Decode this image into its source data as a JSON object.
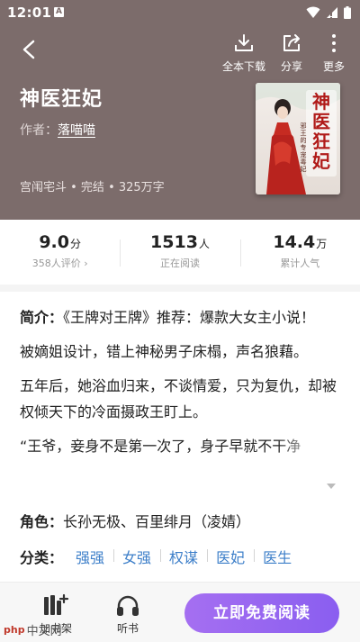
{
  "status_bar": {
    "time": "12:01",
    "notification_letter": "A"
  },
  "header": {
    "actions": [
      {
        "label": "全本下载",
        "icon": "download-icon"
      },
      {
        "label": "分享",
        "icon": "share-icon"
      },
      {
        "label": "更多",
        "icon": "more-vertical-icon"
      }
    ]
  },
  "book": {
    "title": "神医狂妃",
    "author_label": "作者：",
    "author": "落喵喵",
    "meta": "宫闱宅斗 • 完结 • 325万字",
    "cover_title": "神医狂妃",
    "cover_subtitle": "邪王的专宠毒妃"
  },
  "stats": [
    {
      "value": "9.0",
      "unit": "分",
      "sub": "358人评价 ›"
    },
    {
      "value": "1513",
      "unit": "人",
      "sub": "正在阅读"
    },
    {
      "value": "14.4",
      "unit": "万",
      "sub": "累计人气"
    }
  ],
  "intro": {
    "label": "简介：",
    "line1": "《王牌对王牌》推荐：爆款大女主小说！",
    "para2": "被嫡姐设计，错上神秘男子床榻，声名狼藉。",
    "para3": "五年后，她浴血归来，不谈情爱，只为复仇，却被权倾天下的冷面摄政王盯上。",
    "para4": "“王爷，妾身不是第一次了，身子早就不干净"
  },
  "roles": {
    "label": "角色：",
    "value": "长孙无极、百里绯月（凌婧）"
  },
  "categories": {
    "label": "分类：",
    "tags": [
      "强强",
      "女强",
      "权谋",
      "医妃",
      "医生"
    ]
  },
  "bottom_bar": {
    "shelf_label": "加书架",
    "listen_label": "听书",
    "read_label": "立即免费阅读"
  },
  "watermark": {
    "text": "中文网"
  },
  "colors": {
    "header_bg": "#7c6c6b",
    "accent": "#9a66f0",
    "tag": "#3d7fc9"
  }
}
